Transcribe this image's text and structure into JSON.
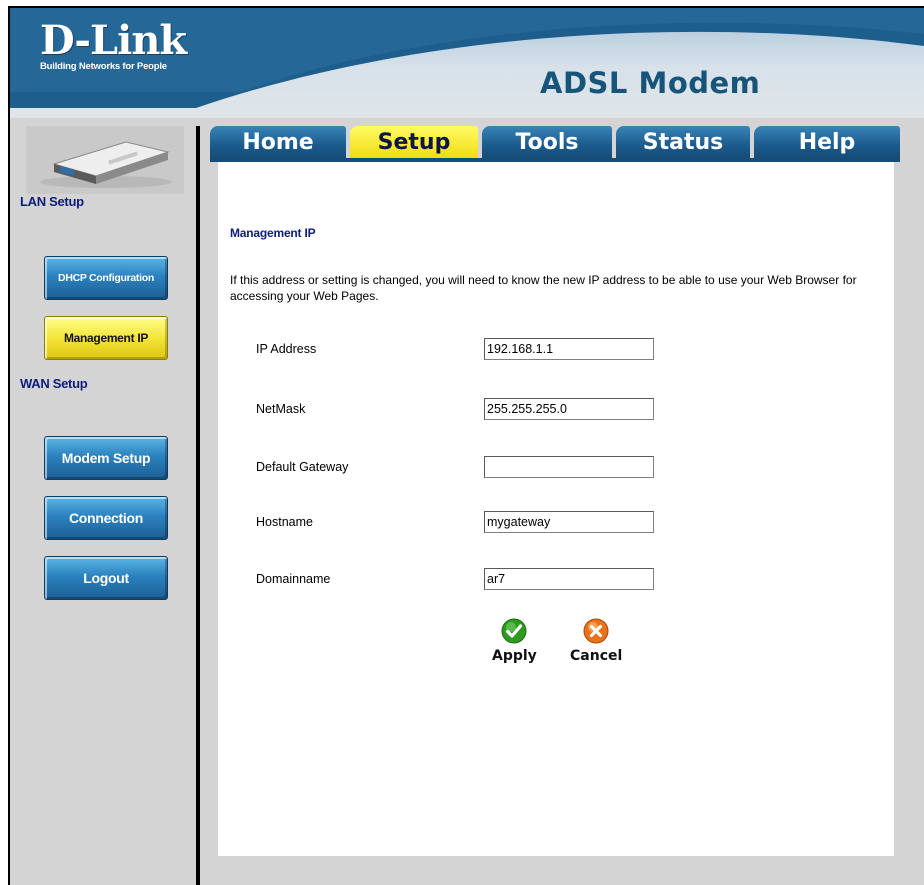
{
  "header": {
    "brand": "D-Link",
    "tagline": "Building Networks for People",
    "product": "ADSL Modem"
  },
  "tabs": [
    {
      "label": "Home",
      "active": false
    },
    {
      "label": "Setup",
      "active": true
    },
    {
      "label": "Tools",
      "active": false
    },
    {
      "label": "Status",
      "active": false
    },
    {
      "label": "Help",
      "active": false
    }
  ],
  "sidebar": {
    "device_icon": "modem-device-icon",
    "sections": [
      {
        "label": "LAN Setup",
        "buttons": [
          {
            "label": "DHCP Configuration",
            "active": false
          },
          {
            "label": "Management IP",
            "active": true
          }
        ]
      },
      {
        "label": "WAN Setup",
        "buttons": [
          {
            "label": "Modem Setup",
            "active": false
          },
          {
            "label": "Connection",
            "active": false
          },
          {
            "label": "Logout",
            "active": false
          }
        ]
      }
    ]
  },
  "main": {
    "title": "Management IP",
    "note": "If this address or setting is changed, you will need to know the new IP address to be able to use your Web Browser for accessing your Web Pages.",
    "fields": [
      {
        "label": "IP Address",
        "value": "192.168.1.1"
      },
      {
        "label": "NetMask",
        "value": "255.255.255.0"
      },
      {
        "label": "Default Gateway",
        "value": ""
      },
      {
        "label": "Hostname",
        "value": "mygateway"
      },
      {
        "label": "Domainname",
        "value": "ar7"
      }
    ],
    "actions": {
      "apply": {
        "label": "Apply",
        "icon": "check-icon",
        "color": "#2e9a1f"
      },
      "cancel": {
        "label": "Cancel",
        "icon": "x-icon",
        "color": "#e8731a"
      }
    }
  },
  "colors": {
    "accent_blue": "#1b5b8d",
    "active_yellow": "#f4e53a",
    "heading_navy": "#0c1d7a"
  }
}
